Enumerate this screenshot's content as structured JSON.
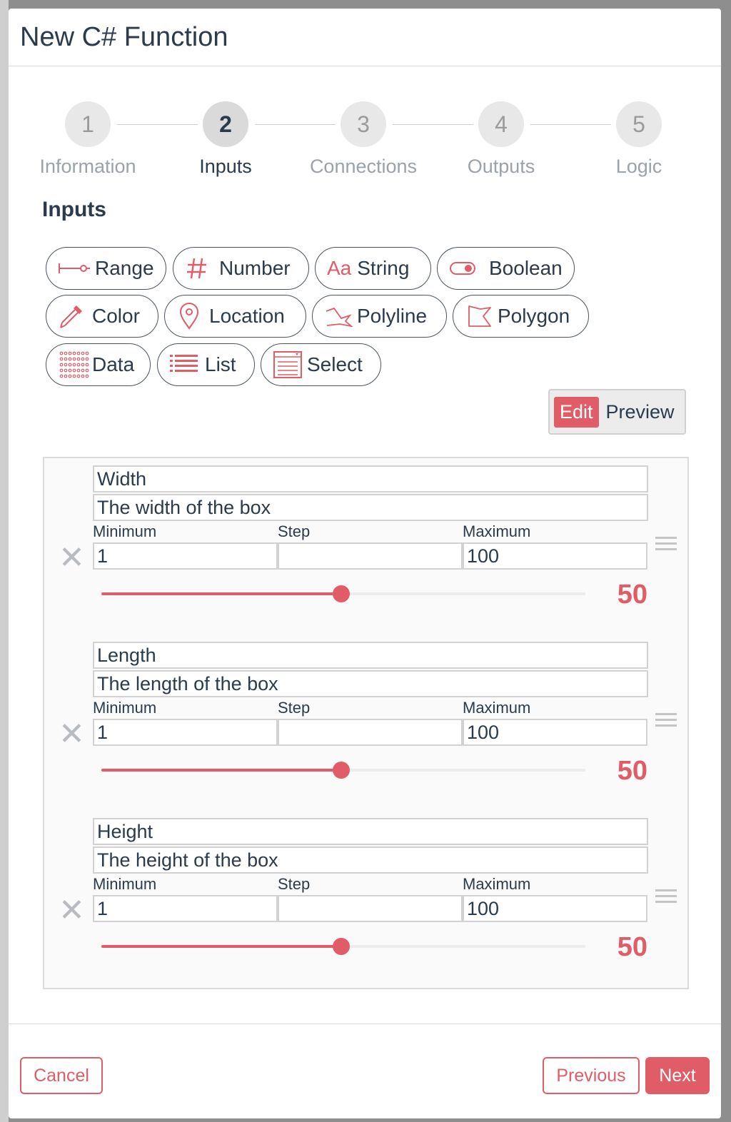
{
  "modal": {
    "title": "New C# Function"
  },
  "stepper": {
    "steps": [
      {
        "num": "1",
        "label": "Information"
      },
      {
        "num": "2",
        "label": "Inputs"
      },
      {
        "num": "3",
        "label": "Connections"
      },
      {
        "num": "4",
        "label": "Outputs"
      },
      {
        "num": "5",
        "label": "Logic"
      }
    ],
    "active_index": 1
  },
  "section": {
    "title": "Inputs"
  },
  "chips": {
    "range": "Range",
    "number": "Number",
    "string_icon": "Aa",
    "string": "String",
    "boolean": "Boolean",
    "color": "Color",
    "location": "Location",
    "polyline": "Polyline",
    "polygon": "Polygon",
    "data": "Data",
    "list": "List",
    "select": "Select"
  },
  "view_toggle": {
    "edit": "Edit",
    "preview": "Preview",
    "selected": "Edit"
  },
  "field_labels": {
    "minimum": "Minimum",
    "step": "Step",
    "maximum": "Maximum"
  },
  "inputs": [
    {
      "name": "Width",
      "description": "The width of the box",
      "minimum": "1",
      "step": "",
      "maximum": "100",
      "value": "50",
      "slider_fraction": 0.4949
    },
    {
      "name": "Length",
      "description": "The length of the box",
      "minimum": "1",
      "step": "",
      "maximum": "100",
      "value": "50",
      "slider_fraction": 0.4949
    },
    {
      "name": "Height",
      "description": "The height of the box",
      "minimum": "1",
      "step": "",
      "maximum": "100",
      "value": "50",
      "slider_fraction": 0.4949
    }
  ],
  "footer": {
    "cancel": "Cancel",
    "previous": "Previous",
    "next": "Next"
  },
  "colors": {
    "accent": "#e05c66",
    "text": "#2b3b4c",
    "muted": "#9aa2aa"
  },
  "icons": {
    "range": "range-slider-icon",
    "number": "hash-icon",
    "string": "text-aa-icon",
    "boolean": "toggle-icon",
    "color": "eyedropper-icon",
    "location": "map-pin-icon",
    "polyline": "polyline-icon",
    "polygon": "polygon-icon",
    "data": "data-grid-icon",
    "list": "list-icon",
    "select": "select-box-icon",
    "remove": "close-icon",
    "drag": "drag-handle-icon"
  }
}
